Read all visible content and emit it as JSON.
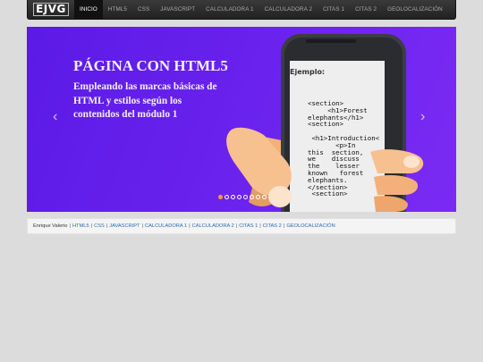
{
  "navbar": {
    "brand": "EJVG",
    "items": [
      {
        "label": "INICIO",
        "active": true
      },
      {
        "label": "HTML5",
        "active": false
      },
      {
        "label": "CSS",
        "active": false
      },
      {
        "label": "JAVASCRIPT",
        "active": false
      },
      {
        "label": "CALCULADORA 1",
        "active": false
      },
      {
        "label": "CALCULADORA 2",
        "active": false
      },
      {
        "label": "CITAS 1",
        "active": false
      },
      {
        "label": "CITAS 2",
        "active": false
      },
      {
        "label": "GEOLOCALIZACIÓN",
        "active": false
      }
    ]
  },
  "carousel": {
    "title": "PÁGINA CON HTML5",
    "text": "Empleando las marcas básicas de HTML y estilos según los contenidos del módulo 1",
    "prev": "‹",
    "next": "›",
    "slides": 8,
    "active_slide": 0,
    "screen_title": "Ejemplo:",
    "code": "<section>\n     <h1>Forest\nelephants</h1>\n<section>\n\n <h1>Introduction<\n       <p>In\nthis  section,\nwe    discuss\nthe    lesser\nknown   forest\nelephants.\n</section>\n <section>"
  },
  "footer": {
    "author": "Enrique Valerio",
    "links": [
      "HTML5",
      "CSS",
      "JAVASCRIPT",
      "CALCULADORA 1",
      "CALCULADORA 2",
      "CITAS 1",
      "CITAS 2",
      "GEOLOCALIZACIÓN"
    ]
  },
  "colors": {
    "navbar": "#222222",
    "slide_bg": "#6a22ee",
    "indicator_active": "#ff9b3b",
    "link": "#2a6ab0"
  }
}
